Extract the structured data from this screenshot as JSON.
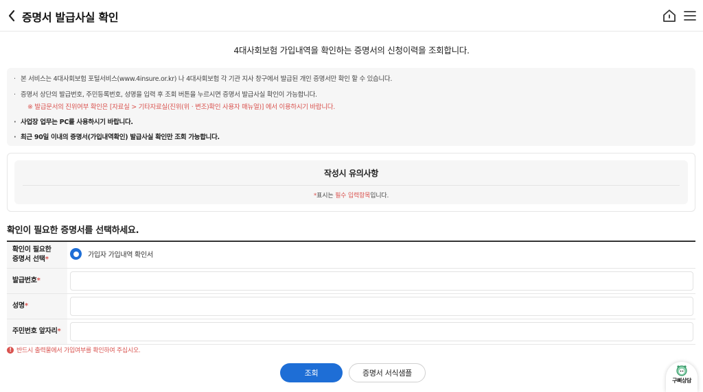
{
  "header": {
    "title": "증명서 발급사실 확인"
  },
  "intro": "4대사회보험 가입내역을 확인하는 증명서의 신청이력을 조회합니다.",
  "notices": {
    "item1": "본 서비스는 4대사회보험 포털서비스(www.4insure.or.kr) 나 4대사회보험 각 기관 지사 창구에서 발급된 개인 증명서만 확인 할 수 있습니다.",
    "item2": "증명서 상단의 발급번호, 주민등록번호, 성명을 입력 후 조회 버튼을 누르시면 증명서 발급사실 확인이 가능합니다.",
    "item2_red": "※ 발급문서의 진위여부 확인은 [자료실 > 기타자료실(진위(위 · 변조)확인 사용자 매뉴얼)] 에서 이용하시기 바랍니다.",
    "item3": "사업장 업무는 PC를 사용하시기 바랍니다.",
    "item4": "최근 90일 이내의 증명서(가입내역확인) 발급사실 확인만 조회 가능합니다."
  },
  "guide": {
    "title": "작성시 유의사항",
    "note_star": "*",
    "note_pre": "표시는 ",
    "note_red": "필수 입력항목",
    "note_post": "입니다."
  },
  "section_title": "확인이 필요한 증명서를 선택하세요.",
  "form": {
    "cert_label_line1": "확인이 필요한",
    "cert_label_line2": "증명서 선택",
    "cert_option": "가입자 가입내역 확인서",
    "issue_no_label": "발급번호",
    "name_label": "성명",
    "rrn_label": "주민번호 앞자리",
    "required_mark": "*",
    "issue_no_value": "",
    "name_value": "",
    "rrn_value": ""
  },
  "warning": "반드시 출력물에서 가입여부를 확인하여 주십시오.",
  "buttons": {
    "query": "조회",
    "sample": "증명서 서식샘플"
  },
  "chat": {
    "label": "구삐상담"
  },
  "colors": {
    "primary": "#1e6ed6",
    "required": "#d9534f"
  }
}
